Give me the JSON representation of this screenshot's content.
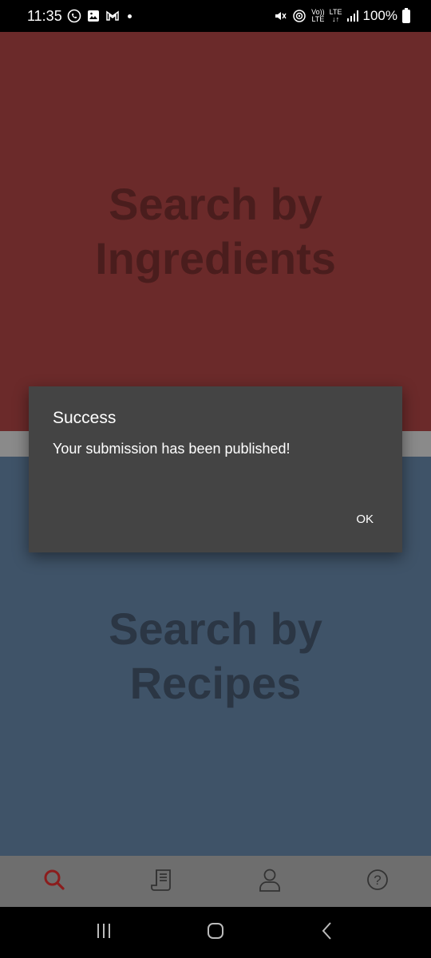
{
  "status_bar": {
    "time": "11:35",
    "battery": "100%",
    "left_icons": [
      "whatsapp-icon",
      "gallery-icon",
      "gmail-icon",
      "dot-icon"
    ],
    "right_icons": [
      "mute-icon",
      "hotspot-icon",
      "volte-icon",
      "lte-icon",
      "signal-icon",
      "battery-icon"
    ],
    "volte_label_top": "Vo))",
    "volte_label_bottom": "LTE",
    "lte_label": "LTE"
  },
  "panels": {
    "ingredients": {
      "label": "Search by Ingredients",
      "color": "#6b2a2a"
    },
    "recipes": {
      "label": "Search by Recipes",
      "color": "#3f5368"
    }
  },
  "bottom_nav": {
    "items": [
      {
        "icon": "search-icon",
        "active": true
      },
      {
        "icon": "recipe-scroll-icon",
        "active": false
      },
      {
        "icon": "profile-icon",
        "active": false
      },
      {
        "icon": "help-icon",
        "active": false
      }
    ],
    "active_color": "#8b1d1d"
  },
  "dialog": {
    "title": "Success",
    "message": "Your submission has been published!",
    "ok_label": "OK"
  },
  "system_nav": {
    "items": [
      "recents-icon",
      "home-icon",
      "back-icon"
    ]
  }
}
